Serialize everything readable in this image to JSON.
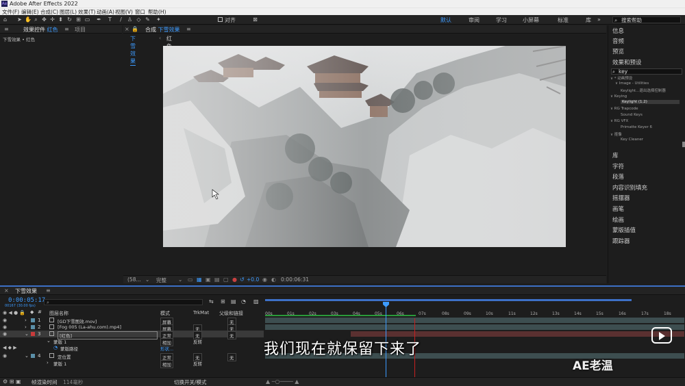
{
  "app": {
    "title": "Adobe After Effects 2022",
    "logo": "Ae"
  },
  "menu": [
    "文件(F)",
    "编辑(E)",
    "合成(C)",
    "图层(L)",
    "效果(T)",
    "动画(A)",
    "视图(V)",
    "窗口",
    "帮助(H)"
  ],
  "toolbar": {
    "align_label": "对齐",
    "workspaces": [
      "默认",
      "审阅",
      "学习",
      "小屏幕",
      "标准",
      "库"
    ],
    "active_workspace": "默认",
    "search_help": "搜索帮助"
  },
  "left_panel": {
    "tab_prefix": "效果控件",
    "tab_layer": "红色",
    "tab2": "项目",
    "subtitle": "下雪效果 • 红色"
  },
  "comp_panel": {
    "tab_prefix": "合成",
    "tab_comp": "下雪效果",
    "breadcrumb_comp": "下雪效果",
    "breadcrumb_layer": "红色",
    "zoom": "(58...",
    "quality": "完整",
    "exposure": "+0.0",
    "timecode": "0:00:06:31"
  },
  "right_panel": {
    "items_top": [
      "信息",
      "音频",
      "预览",
      "效果和预设"
    ],
    "search_value": "key",
    "tree": [
      {
        "text": "∨ * 动画预设",
        "indent": 0,
        "selected": false
      },
      {
        "text": "∨ Image - Utilities",
        "indent": 1,
        "selected": false
      },
      {
        "text": "Keylight...退出选择控制器",
        "indent": 2,
        "selected": false
      },
      {
        "text": "∨ Keying",
        "indent": 0,
        "selected": false
      },
      {
        "text": "Keylight (1.2)",
        "indent": 2,
        "selected": true
      },
      {
        "text": "∨ RG Trapcode",
        "indent": 0,
        "selected": false
      },
      {
        "text": "Sound Keys",
        "indent": 2,
        "selected": false
      },
      {
        "text": "∨ RG VFX",
        "indent": 0,
        "selected": false
      },
      {
        "text": "Primatte Keyer 6",
        "indent": 2,
        "selected": false
      },
      {
        "text": "∨ 抠像",
        "indent": 0,
        "selected": false
      },
      {
        "text": "Key Cleaner",
        "indent": 2,
        "selected": false
      }
    ],
    "items_bottom": [
      "库",
      "字符",
      "段落",
      "内容识别填充",
      "摇摆器",
      "画笔",
      "绘画",
      "蒙版插值",
      "跟踪器"
    ]
  },
  "timeline": {
    "comp_name": "下雪效果",
    "timecode": "0:00:05:17",
    "fps": "00167 (30.00 fps)",
    "search_placeholder": "",
    "columns": {
      "name": "图层名称",
      "mode": "模式",
      "trkmat": "TrkMat",
      "parent": "父级和链接"
    },
    "ruler": [
      "00s",
      "01s",
      "02s",
      "03s",
      "04s",
      "05s",
      "06s",
      "07s",
      "08s",
      "09s",
      "10s",
      "11s",
      "12s",
      "13s",
      "14s",
      "15s",
      "16s",
      "17s",
      "18s"
    ],
    "layers": [
      {
        "num": "1",
        "name": "[GD下雪图效.mov]",
        "mode": "屏幕",
        "trkmat": "",
        "parent": "无",
        "color": "#5a8fa8"
      },
      {
        "num": "2",
        "name": "[Fog 005 (La-ahu.com).mp4]",
        "mode": "屏幕",
        "trkmat": "无",
        "parent": "无",
        "color": "#5a8fa8"
      },
      {
        "num": "3",
        "name": "[红色]",
        "mode": "正常",
        "trkmat": "无",
        "parent": "无",
        "color": "#c83b3b"
      },
      {
        "sub": true,
        "name": "蒙版 1",
        "mode": "相加",
        "trkmat": "反转"
      },
      {
        "sub2": true,
        "name": "蒙版路径",
        "extra": "形状..."
      },
      {
        "num": "4",
        "name": "定位置",
        "mode": "正常",
        "trkmat": "无",
        "parent": "无",
        "color": "#5a8fa8"
      },
      {
        "sub": true,
        "name": "蒙版 1",
        "mode": "相加",
        "trkmat": "反转"
      }
    ],
    "footer_left": "帧渲染时间",
    "footer_value": "114毫秒",
    "footer_mid": "切换开关/模式"
  },
  "overlay": {
    "subtitle": "我们现在就保留下来了",
    "watermark": "AE老温"
  },
  "colors": {
    "accent": "#3d9bff",
    "playhead": "#3d9bff",
    "work_end": "#c82020"
  }
}
